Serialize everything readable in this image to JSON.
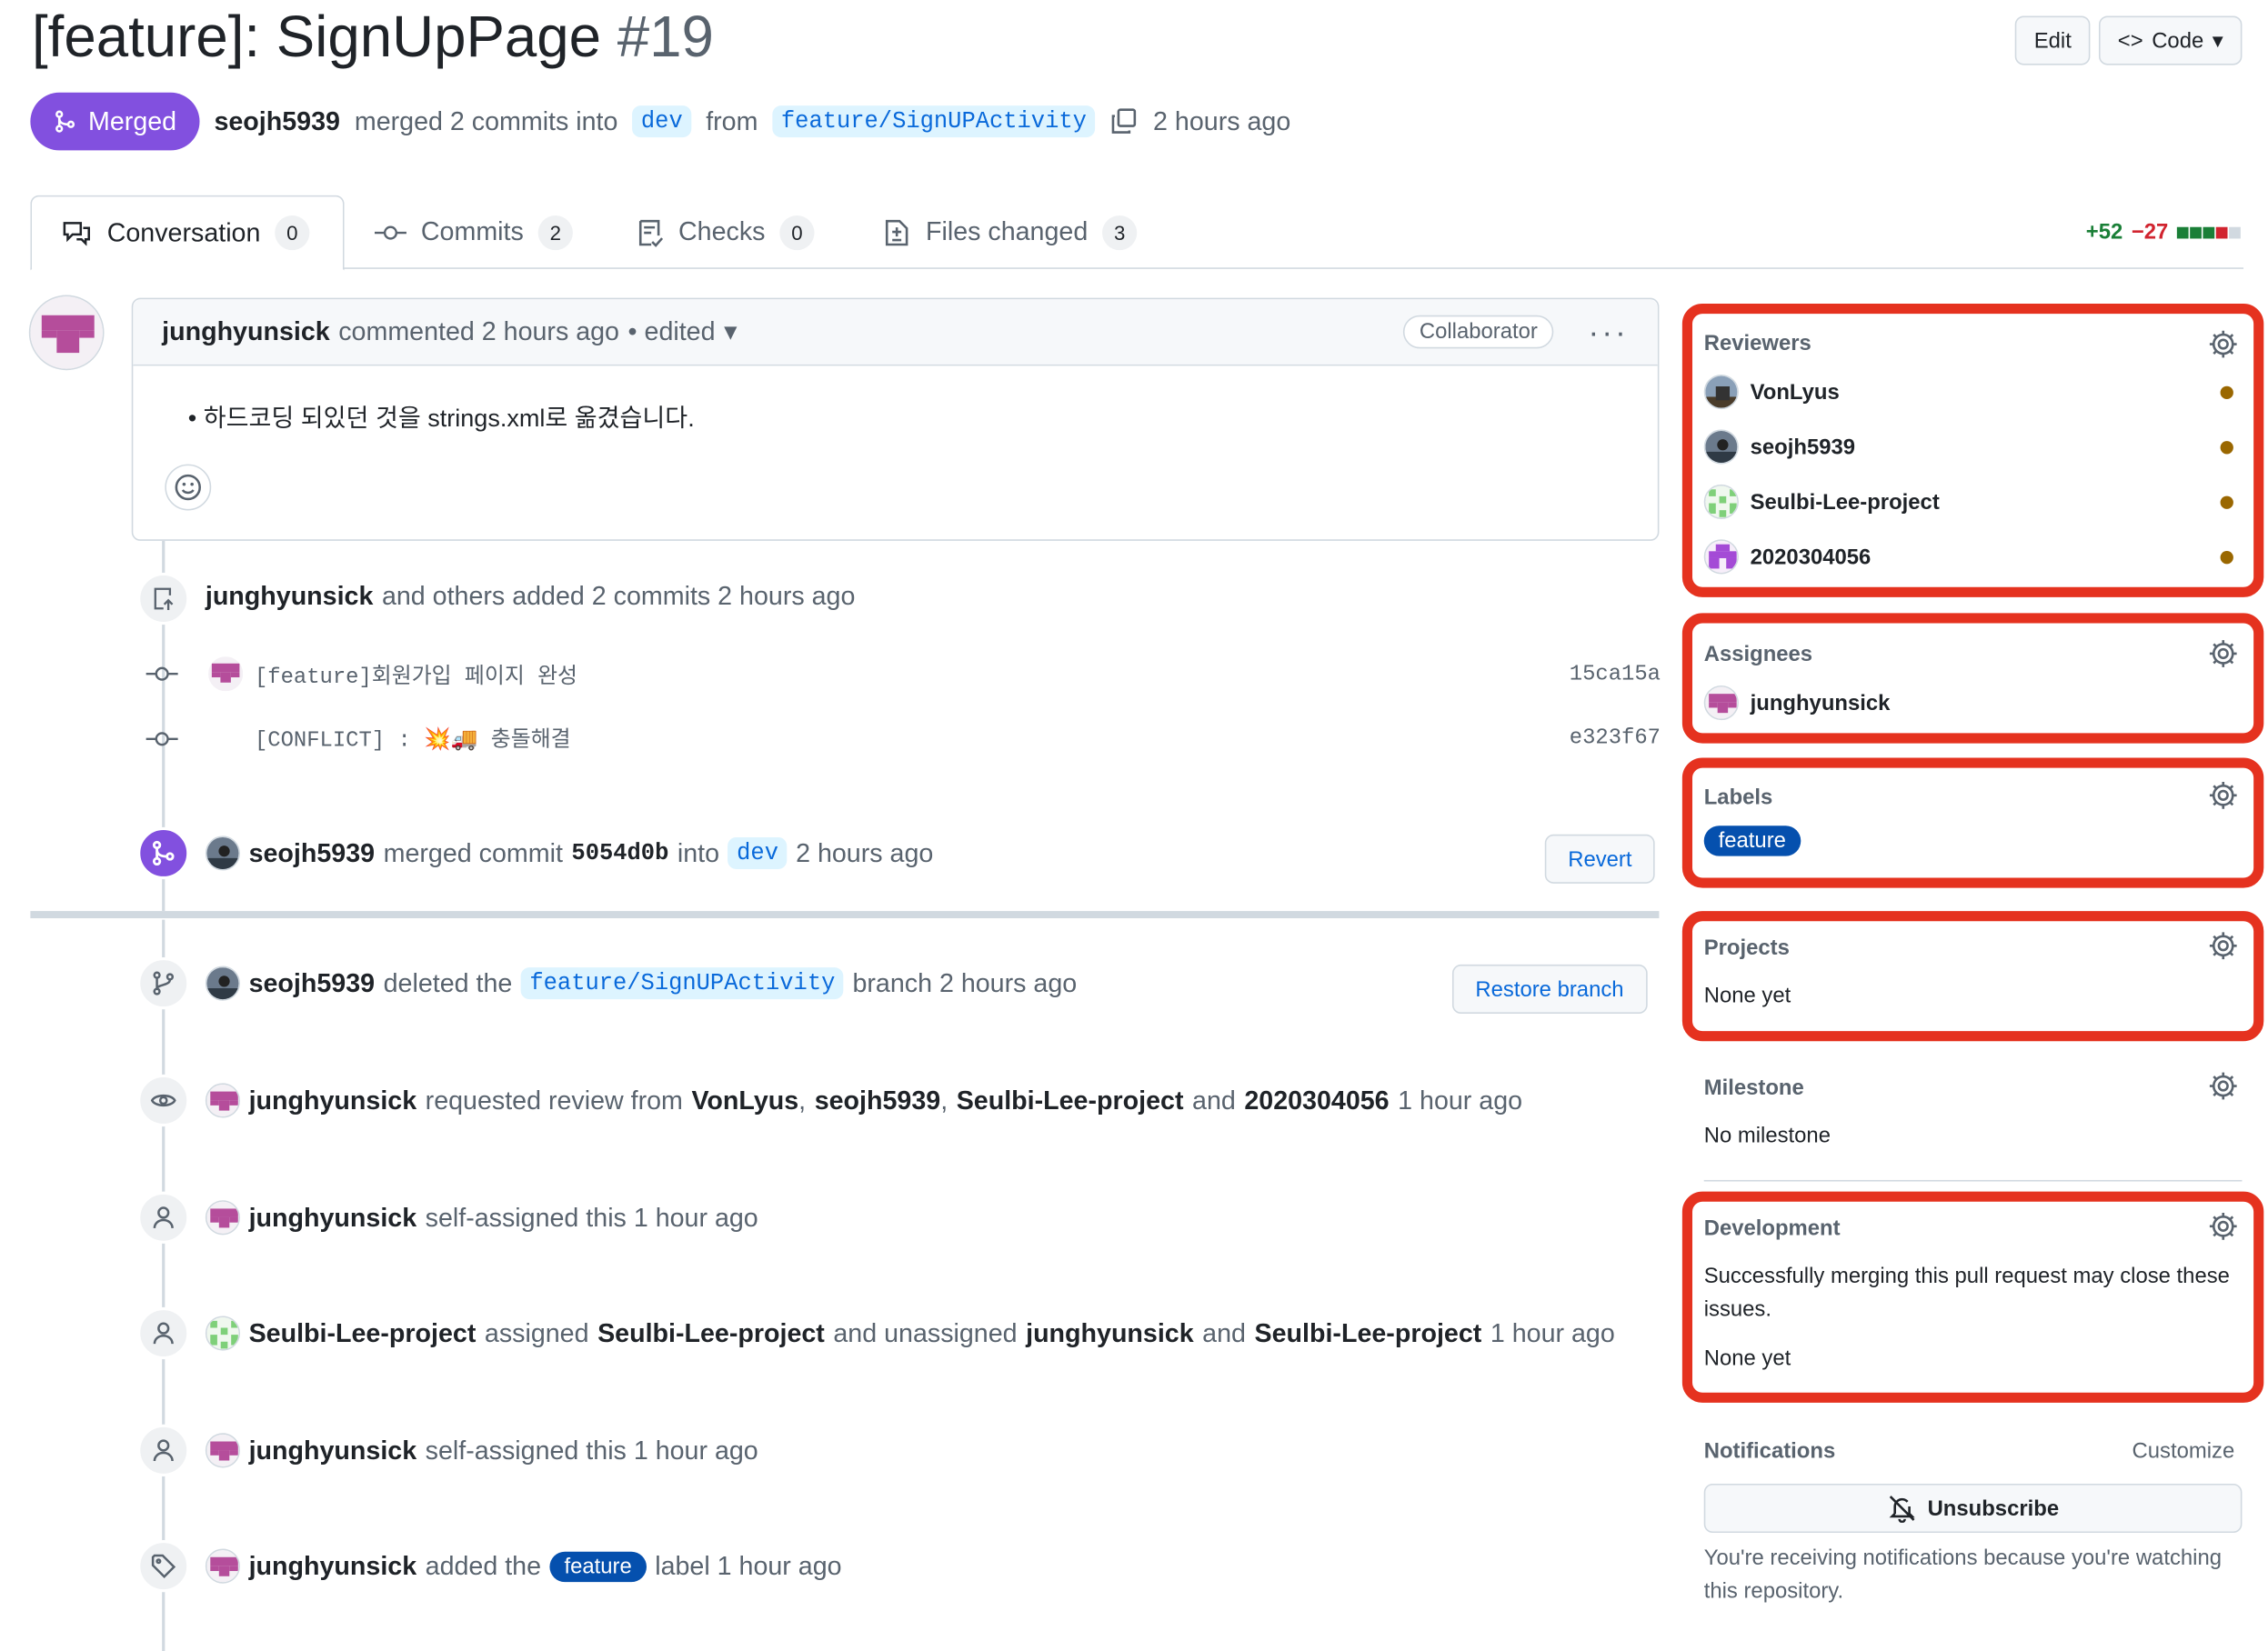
{
  "pr": {
    "title": "[feature]: SignUpPage",
    "number": "#19",
    "status": "Merged",
    "author": "seojh5939",
    "action": "merged 2 commits into",
    "base": "dev",
    "from": "from",
    "head": "feature/SignUPActivity",
    "time": "2 hours ago"
  },
  "header": {
    "edit": "Edit",
    "code": "Code"
  },
  "tabs": [
    {
      "label": "Conversation",
      "count": "0"
    },
    {
      "label": "Commits",
      "count": "2"
    },
    {
      "label": "Checks",
      "count": "0"
    },
    {
      "label": "Files changed",
      "count": "3"
    }
  ],
  "diffstat": {
    "add": "+52",
    "del": "−27"
  },
  "comment": {
    "author": "junghyunsick",
    "action": "commented 2 hours ago",
    "edited": "• edited",
    "role": "Collaborator",
    "bullet": "하드코딩 되있던 것을 strings.xml로 옮겼습니다."
  },
  "commits_event": {
    "author": "junghyunsick",
    "text": "and others added 2 commits 2 hours ago",
    "items": [
      {
        "msg": "[feature]회원가입 페이지 완성",
        "sha": "15ca15a"
      },
      {
        "msg": "[CONFLICT] : 💥🚚 충돌해결",
        "sha": "e323f67"
      }
    ]
  },
  "merge_event": {
    "author": "seojh5939",
    "text1": "merged commit",
    "commit": "5054d0b",
    "text2": "into",
    "base": "dev",
    "time": "2 hours ago",
    "revert": "Revert"
  },
  "events": [
    {
      "author": "seojh5939",
      "text": "deleted the",
      "branch": "feature/SignUPActivity",
      "text2": "branch 2 hours ago",
      "btn": "Restore branch"
    },
    {
      "author": "junghyunsick",
      "text": "requested review from",
      "r1": "VonLyus",
      "r2": "seojh5939",
      "r3": "Seulbi-Lee-project",
      "and": "and",
      "r4": "2020304056",
      "time": "1 hour ago"
    },
    {
      "author": "junghyunsick",
      "text": "self-assigned this 1 hour ago"
    },
    {
      "author": "Seulbi-Lee-project",
      "text": "assigned",
      "a1": "Seulbi-Lee-project",
      "and1": "and unassigned",
      "a2": "junghyunsick",
      "and2": "and",
      "a3": "Seulbi-Lee-project",
      "time": "1 hour ago"
    },
    {
      "author": "junghyunsick",
      "text": "self-assigned this 1 hour ago"
    },
    {
      "author": "junghyunsick",
      "text": "added the",
      "label": "feature",
      "text2": "label 1 hour ago"
    }
  ],
  "sidebar": {
    "reviewers": {
      "title": "Reviewers",
      "items": [
        "VonLyus",
        "seojh5939",
        "Seulbi-Lee-project",
        "2020304056"
      ]
    },
    "assignees": {
      "title": "Assignees",
      "items": [
        "junghyunsick"
      ]
    },
    "labels": {
      "title": "Labels",
      "items": [
        "feature"
      ]
    },
    "projects": {
      "title": "Projects",
      "value": "None yet"
    },
    "milestone": {
      "title": "Milestone",
      "value": "No milestone"
    },
    "development": {
      "title": "Development",
      "desc": "Successfully merging this pull request may close these issues.",
      "value": "None yet"
    },
    "notifications": {
      "title": "Notifications",
      "customize": "Customize",
      "unsubscribe": "Unsubscribe",
      "note": "You're receiving notifications because you're watching this repository."
    }
  },
  "colors": {
    "merged": "#8250df",
    "highlight": "#e5321f",
    "label": "#0550ae",
    "link": "#0969da"
  }
}
